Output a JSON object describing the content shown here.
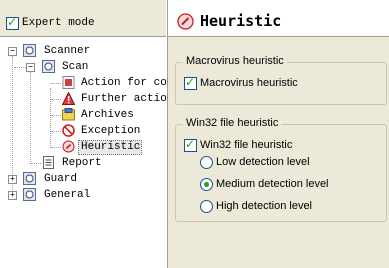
{
  "expert_mode": {
    "label": "Expert mode",
    "checked": true
  },
  "tree": {
    "scanner": "Scanner",
    "scan": "Scan",
    "action": "Action for conc",
    "further": "Further actions",
    "archives": "Archives",
    "exception": "Exception",
    "heuristic": "Heuristic",
    "report": "Report",
    "guard": "Guard",
    "general": "General"
  },
  "panel": {
    "title": "Heuristic",
    "macro_group": "Macrovirus heuristic",
    "macro_option": "Macrovirus heuristic",
    "win32_group": "Win32 file heuristic",
    "win32_option": "Win32 file heuristic",
    "levels": [
      "Low detection level",
      "Medium detection level",
      "High detection level"
    ],
    "selected_level": "Medium detection level"
  },
  "colors": {
    "accent_check": "#21a121",
    "selection": "#e8e8e8",
    "panel_bg": "#ece9d8"
  },
  "icons": [
    "checkbox-icon",
    "folder-icon",
    "action-icon",
    "warning-icon",
    "archive-icon",
    "exception-icon",
    "heuristic-icon",
    "report-icon"
  ]
}
